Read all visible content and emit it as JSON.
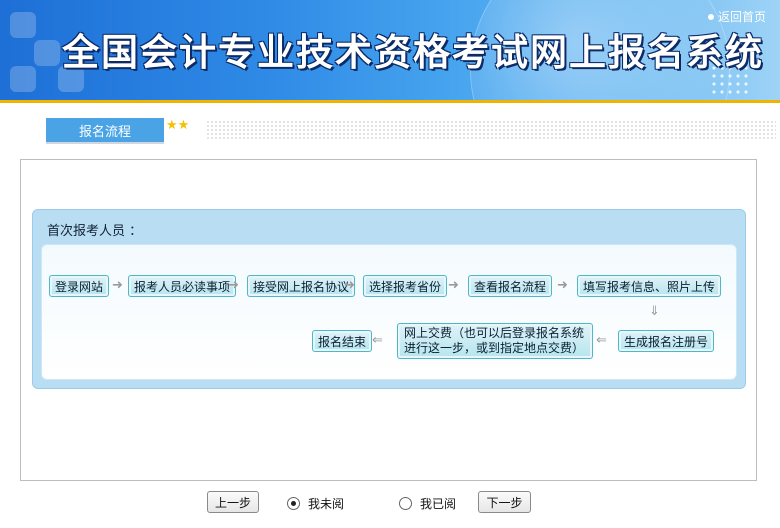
{
  "header": {
    "title": "全国会计专业技术资格考试网上报名系统",
    "return_home": "返回首页"
  },
  "nav": {
    "tab_label": "报名流程",
    "stars": "★★"
  },
  "flow": {
    "title": "首次报考人员 ：",
    "row1": [
      "登录网站",
      "报考人员必读事项",
      "接受网上报名协议",
      "选择报考省份",
      "查看报名流程",
      "填写报考信息、照片上传"
    ],
    "row2_register": "生成报名注册号",
    "row2_payment": "网上交费（也可以后登录报名系统进行这一步，或到指定地点交费）",
    "row2_end": "报名结束",
    "arrow_right": "➜",
    "arrow_left": "⇐",
    "arrow_down": "⇓"
  },
  "controls": {
    "prev_label": "上一步",
    "radio_unread": "我未阅",
    "radio_read": "我已阅",
    "next_label": "下一步",
    "selected": "unread"
  },
  "colors": {
    "header_blue": "#2f8be6",
    "stripe": "#f0b400",
    "tab_blue": "#4aa3e5",
    "step_border": "#4cb8c9"
  }
}
